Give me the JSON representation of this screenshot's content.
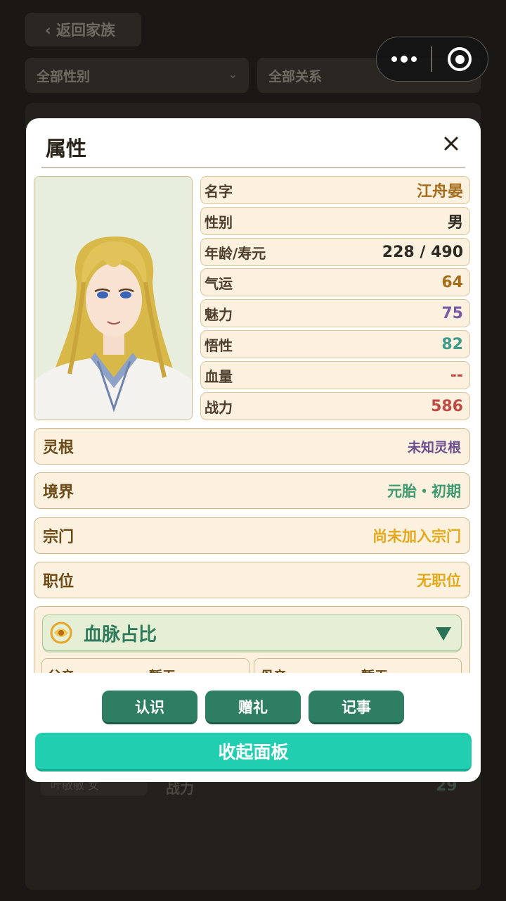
{
  "background": {
    "back_label": "‹ 返回家族",
    "filter_gender": "全部性别",
    "filter_relation": "全部关系",
    "row_tag": "叶敏敏 女",
    "row_label": "战力",
    "row_value": "29"
  },
  "capsule": {
    "more_icon": "more-dots-icon",
    "close_icon": "target-icon"
  },
  "modal": {
    "title": "属性",
    "close_icon": "close-icon"
  },
  "stats": [
    {
      "label": "名字",
      "value": "江舟晏",
      "color": "#a56d1b"
    },
    {
      "label": "性别",
      "value": "男",
      "color": "#2e2a24"
    },
    {
      "label": "年龄/寿元",
      "value": "228 / 490",
      "color": "#2e2a24"
    },
    {
      "label": "气运",
      "value": "64",
      "color": "#a56d1b"
    },
    {
      "label": "魅力",
      "value": "75",
      "color": "#7a5aa6"
    },
    {
      "label": "悟性",
      "value": "82",
      "color": "#3f9a8a"
    },
    {
      "label": "血量",
      "value": "--",
      "color": "#c04a43"
    },
    {
      "label": "战力",
      "value": "586",
      "color": "#c04a43"
    }
  ],
  "info": [
    {
      "label": "灵根",
      "value": "未知灵根",
      "color": "#6c4e8e"
    },
    {
      "label": "境界",
      "value": "元胎・初期",
      "color": "#3f9a72"
    },
    {
      "label": "宗门",
      "value": "尚未加入宗门",
      "color": "#e3a81c"
    },
    {
      "label": "职位",
      "value": "无职位",
      "color": "#e3a81c"
    }
  ],
  "bloodline": {
    "title": "血脉占比",
    "cells": [
      {
        "label": "父亲",
        "value": "暂无"
      },
      {
        "label": "母亲",
        "value": "暂无"
      }
    ]
  },
  "actions": {
    "recognize": "认识",
    "gift": "赠礼",
    "record": "记事",
    "collapse": "收起面板"
  }
}
